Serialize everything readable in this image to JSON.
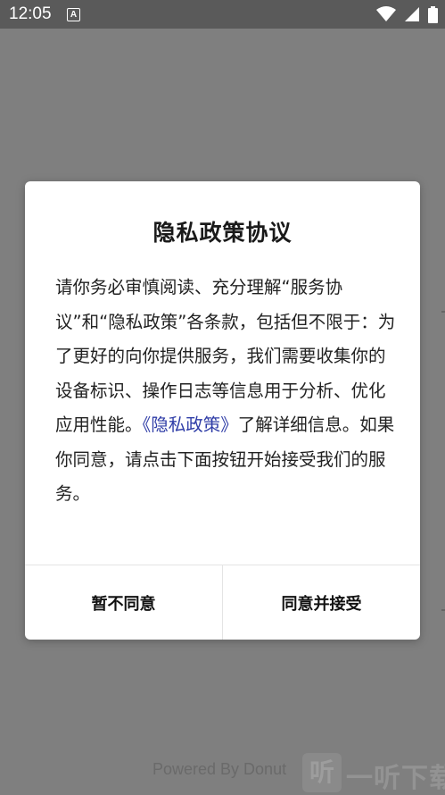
{
  "status_bar": {
    "time": "12:05",
    "notification_icon_letter": "A",
    "icons": [
      "wifi-icon",
      "signal-icon",
      "battery-icon"
    ]
  },
  "dialog": {
    "title": "隐私政策协议",
    "body_text": "请你务必审慎阅读、充分理解“服务协议”和“隐私政策”各条款，包括但不限于：为了更好的向你提供服务，我们需要收集你的设备标识、操作日志等信息用于分析、优化应用性能。",
    "link_text": "《隐私政策》",
    "body_after_link": "了解详细信息。如果你同意，请点击下面按钮开始接受我们的服务。",
    "decline_label": "暂不同意",
    "accept_label": "同意并接受"
  },
  "footer": {
    "powered_by": "Powered By Donut",
    "watermark_logo_char": "听",
    "watermark_text": "一听下载"
  },
  "colors": {
    "overlay": "#7f7f7f",
    "status_bar": "#5a5a5a",
    "link": "#2f3da7",
    "divider": "#e4e4e4"
  }
}
